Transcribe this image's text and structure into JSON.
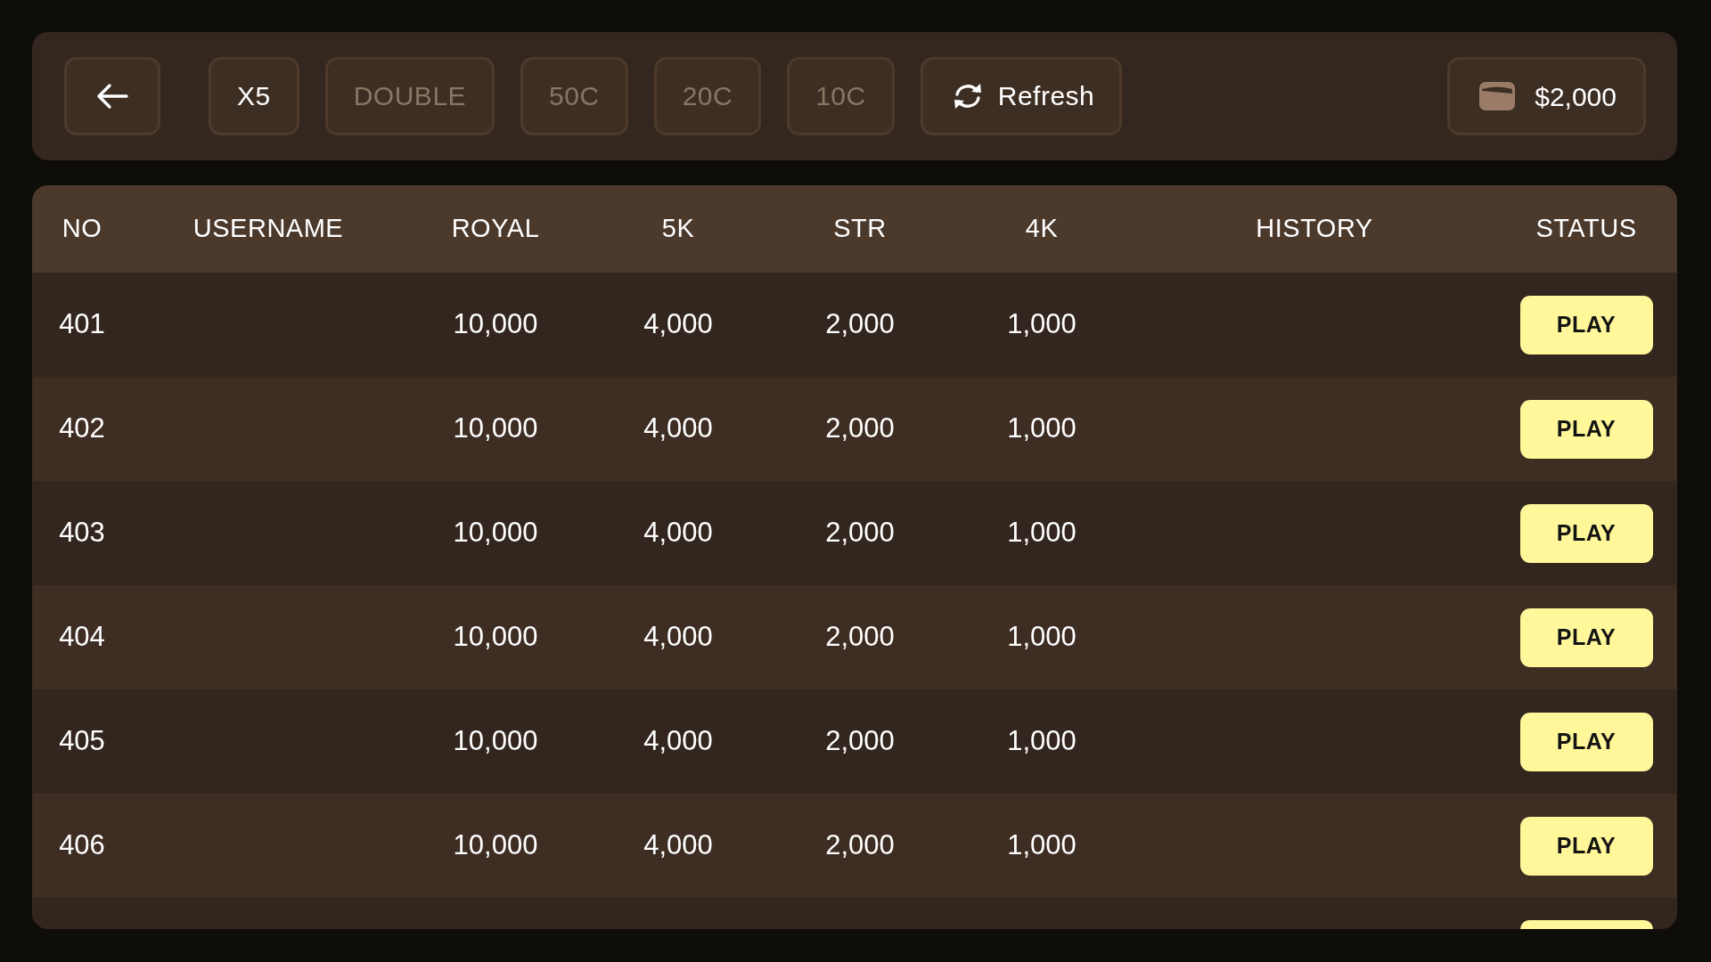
{
  "toolbar": {
    "bet_options": [
      {
        "label": "X5",
        "disabled": false
      },
      {
        "label": "DOUBLE",
        "disabled": true
      },
      {
        "label": "50C",
        "disabled": true
      },
      {
        "label": "20C",
        "disabled": true
      },
      {
        "label": "10C",
        "disabled": true
      }
    ],
    "refresh_button": {
      "label": "Refresh"
    },
    "balance": "$2,000"
  },
  "table": {
    "columns": [
      "NO",
      "USERNAME",
      "ROYAL",
      "5K",
      "STR",
      "4K",
      "HISTORY",
      "STATUS"
    ],
    "rows": [
      {
        "kind": "full",
        "no": "401",
        "royal": "10,000",
        "5k": "4,000",
        "str": "2,000",
        "4k": "1,000",
        "status": "PLAY"
      },
      {
        "kind": "full",
        "no": "402",
        "royal": "10,000",
        "5k": "4,000",
        "str": "2,000",
        "4k": "1,000",
        "status": "PLAY"
      },
      {
        "kind": "full",
        "no": "403",
        "royal": "10,000",
        "5k": "4,000",
        "str": "2,000",
        "4k": "1,000",
        "status": "PLAY"
      },
      {
        "kind": "full",
        "no": "404",
        "royal": "10,000",
        "5k": "4,000",
        "str": "2,000",
        "4k": "1,000",
        "status": "PLAY"
      },
      {
        "kind": "full",
        "no": "405",
        "royal": "10,000",
        "5k": "4,000",
        "str": "2,000",
        "4k": "1,000",
        "status": "PLAY"
      },
      {
        "kind": "full",
        "no": "406",
        "royal": "10,000",
        "5k": "4,000",
        "str": "2,000",
        "4k": "1,000",
        "status": "PLAY"
      },
      {
        "kind": "cut-off"
      }
    ]
  }
}
